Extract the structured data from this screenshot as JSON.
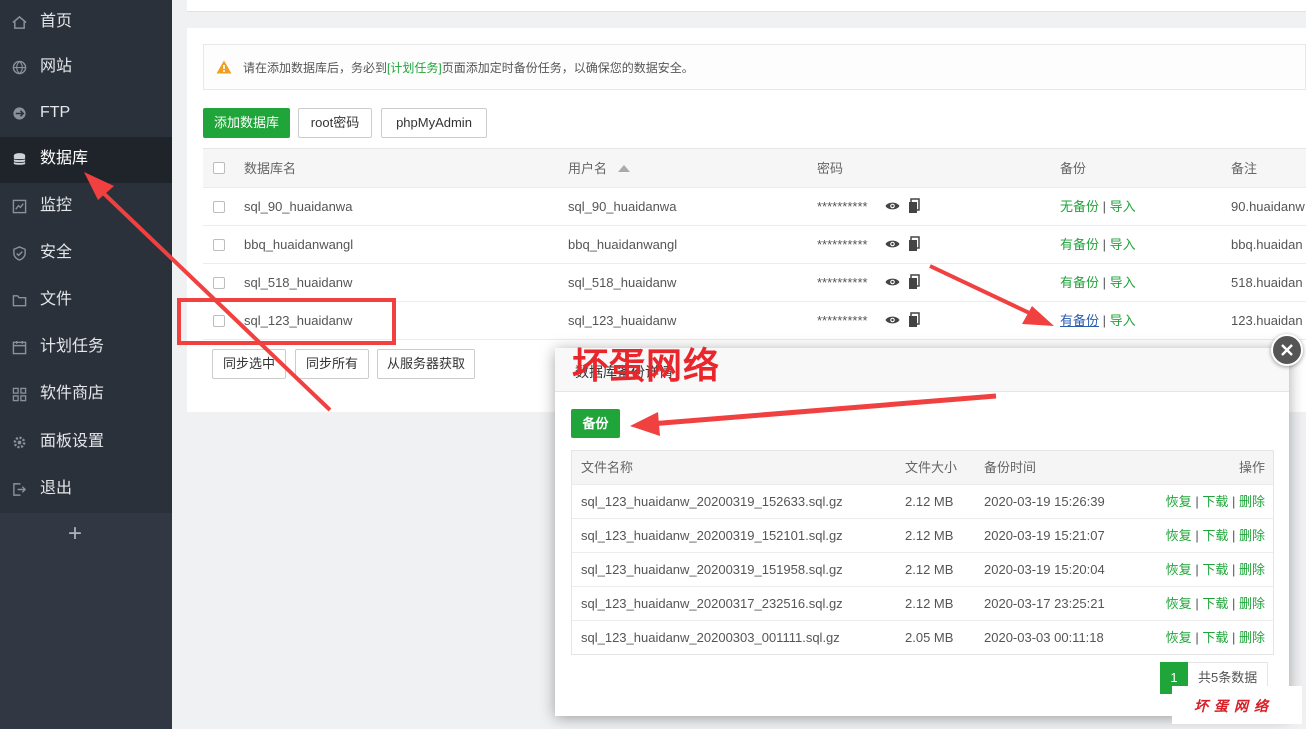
{
  "sidebar": {
    "items": [
      {
        "label": "首页",
        "icon": "home-icon"
      },
      {
        "label": "网站",
        "icon": "globe-icon"
      },
      {
        "label": "FTP",
        "icon": "ftp-icon"
      },
      {
        "label": "数据库",
        "icon": "database-icon",
        "active": true
      },
      {
        "label": "监控",
        "icon": "monitor-icon"
      },
      {
        "label": "安全",
        "icon": "shield-icon"
      },
      {
        "label": "文件",
        "icon": "folder-icon"
      },
      {
        "label": "计划任务",
        "icon": "calendar-icon"
      },
      {
        "label": "软件商店",
        "icon": "grid-icon"
      },
      {
        "label": "面板设置",
        "icon": "gear-icon"
      },
      {
        "label": "退出",
        "icon": "logout-icon"
      }
    ],
    "add_label": "+"
  },
  "tip": {
    "before": "请在添加数据库后，务必到",
    "link": "[计划任务]",
    "after": "页面添加定时备份任务，以确保您的数据安全。"
  },
  "toolbar": {
    "add_db": "添加数据库",
    "root_pwd": "root密码",
    "phpmyadmin": "phpMyAdmin"
  },
  "db_table": {
    "headers": {
      "name": "数据库名",
      "user": "用户名",
      "password": "密码",
      "backup": "备份",
      "note": "备注"
    },
    "rows": [
      {
        "name": "sql_90_huaidanwa",
        "user": "sql_90_huaidanwa",
        "password": "**********",
        "backup": "无备份",
        "import": "导入",
        "note": "90.huaidanw"
      },
      {
        "name": "bbq_huaidanwangl",
        "user": "bbq_huaidanwangl",
        "password": "**********",
        "backup": "有备份",
        "import": "导入",
        "note": "bbq.huaidan"
      },
      {
        "name": "sql_518_huaidanw",
        "user": "sql_518_huaidanw",
        "password": "**********",
        "backup": "有备份",
        "import": "导入",
        "note": "518.huaidan"
      },
      {
        "name": "sql_123_huaidanw",
        "user": "sql_123_huaidanw",
        "password": "**********",
        "backup": "有备份",
        "import": "导入",
        "note": "123.huaidan"
      }
    ],
    "separator": "|"
  },
  "footer_buttons": {
    "sync_selected": "同步选中",
    "sync_all": "同步所有",
    "fetch_server": "从服务器获取"
  },
  "modal": {
    "title": "数据库备份详情",
    "backup_button": "备份",
    "headers": {
      "filename": "文件名称",
      "size": "文件大小",
      "time": "备份时间",
      "ops": "操作"
    },
    "rows": [
      {
        "filename": "sql_123_huaidanw_20200319_152633.sql.gz",
        "size": "2.12 MB",
        "time": "2020-03-19 15:26:39"
      },
      {
        "filename": "sql_123_huaidanw_20200319_152101.sql.gz",
        "size": "2.12 MB",
        "time": "2020-03-19 15:21:07"
      },
      {
        "filename": "sql_123_huaidanw_20200319_151958.sql.gz",
        "size": "2.12 MB",
        "time": "2020-03-19 15:20:04"
      },
      {
        "filename": "sql_123_huaidanw_20200317_232516.sql.gz",
        "size": "2.12 MB",
        "time": "2020-03-17 23:25:21"
      },
      {
        "filename": "sql_123_huaidanw_20200303_001111.sql.gz",
        "size": "2.05 MB",
        "time": "2020-03-03 00:11:18"
      }
    ],
    "ops": {
      "restore": "恢复",
      "download": "下载",
      "delete": "删除"
    },
    "pager": {
      "current": "1",
      "info": "共5条数据"
    }
  },
  "annotations": {
    "brand": "坏蛋网络",
    "watermark": "坏蛋网络"
  },
  "colors": {
    "sidebar": "#2b313b",
    "accent": "#20a53a",
    "annotation": "#f04040"
  }
}
